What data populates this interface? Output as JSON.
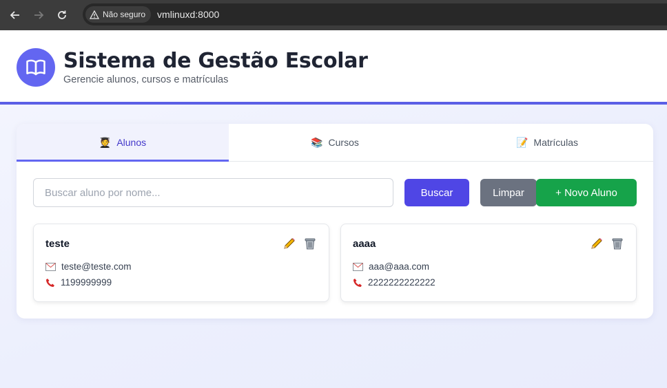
{
  "browser": {
    "security_label": "Não seguro",
    "url": "vmlinuxd:8000"
  },
  "header": {
    "title": "Sistema de Gestão Escolar",
    "subtitle": "Gerencie alunos, cursos e matrículas",
    "logo_icon": "book-open-icon",
    "accent_color": "#6366f1"
  },
  "tabs": [
    {
      "label": "Alunos",
      "icon": "student-icon",
      "active": true
    },
    {
      "label": "Cursos",
      "icon": "books-icon",
      "active": false
    },
    {
      "label": "Matrículas",
      "icon": "memo-icon",
      "active": false
    }
  ],
  "toolbar": {
    "search_placeholder": "Buscar aluno por nome...",
    "search_value": "",
    "search_button": "Buscar",
    "clear_button": "Limpar",
    "new_button": "+ Novo Aluno"
  },
  "students": [
    {
      "name": "teste",
      "email": "teste@teste.com",
      "phone": "1199999999"
    },
    {
      "name": "aaaa",
      "email": "aaa@aaa.com",
      "phone": "2222222222222"
    }
  ],
  "colors": {
    "primary": "#4f46e5",
    "secondary": "#6b7280",
    "success": "#16a34a"
  }
}
